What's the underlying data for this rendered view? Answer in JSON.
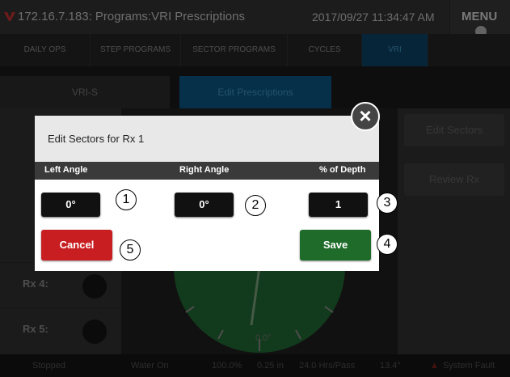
{
  "header": {
    "title": "172.16.7.183: Programs:VRI Prescriptions",
    "datetime": "2017/09/27 11:34:47 AM",
    "menu_label": "MENU"
  },
  "nav": [
    "DAILY OPS",
    "STEP PROGRAMS",
    "SECTOR PROGRAMS",
    "CYCLES",
    "VRI"
  ],
  "subtabs": [
    "VRI-S",
    "Edit Prescriptions"
  ],
  "rx_list": [
    "Rx 4:",
    "Rx 5:"
  ],
  "right_buttons": [
    "Edit Sectors",
    "Review Rx"
  ],
  "gauge_label": "0.0°",
  "status": {
    "state": "Stopped",
    "water": "Water On",
    "percent": "100.0%",
    "depth": "0.25 in",
    "hrs": "24.0 Hrs/Pass",
    "angle": "13.4°",
    "fault": "System Fault"
  },
  "modal": {
    "title": "Edit Sectors for Rx 1",
    "columns": [
      "Left Angle",
      "Right Angle",
      "% of Depth"
    ],
    "left_angle": "0°",
    "right_angle": "0°",
    "depth_percent": "1",
    "cancel_label": "Cancel",
    "save_label": "Save"
  },
  "callouts": [
    "1",
    "2",
    "3",
    "4",
    "5"
  ],
  "colors": {
    "accent_blue": "#0a4a70",
    "cancel_red": "#c81e22",
    "save_green": "#1e6b2a",
    "gauge_green": "#1d5a2c"
  }
}
